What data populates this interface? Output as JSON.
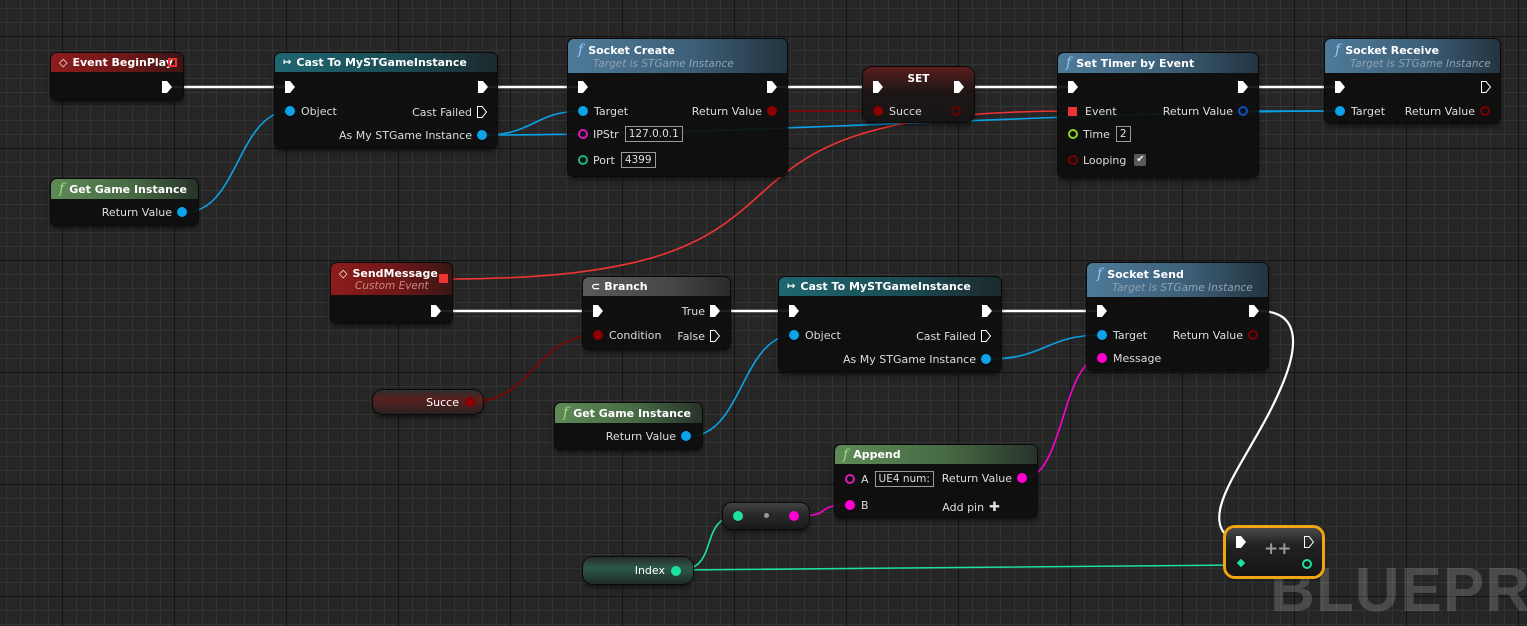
{
  "watermark": "BLUEPR",
  "colors": {
    "exec": "#ffffff",
    "object": "#0aa2e8",
    "boolean": "#8b0000",
    "string": "#ff00d4",
    "integer": "#1ee0a0",
    "float": "#9ae02a",
    "event_delegate": "#ee3333",
    "selection": "#f1a512"
  },
  "nodes": {
    "event_beginplay": {
      "title": "Event BeginPlay",
      "icon": "event-diamond-icon"
    },
    "get_game_instance_1": {
      "title": "Get Game Instance",
      "return_label": "Return Value",
      "icon": "function-icon"
    },
    "cast_1": {
      "title": "Cast To MySTGameInstance",
      "object_label": "Object",
      "cast_failed_label": "Cast Failed",
      "as_label": "As My STGame Instance",
      "icon": "cast-arrow-icon"
    },
    "socket_create": {
      "title": "Socket Create",
      "subtitle": "Target is STGame Instance",
      "target_label": "Target",
      "return_label": "Return Value",
      "ipstr_label": "IPStr",
      "ipstr_value": "127.0.0.1",
      "port_label": "Port",
      "port_value": "4399",
      "icon": "function-icon"
    },
    "set_node": {
      "title": "SET",
      "var_label": "Succe"
    },
    "set_timer": {
      "title": "Set Timer by Event",
      "event_label": "Event",
      "return_label": "Return Value",
      "time_label": "Time",
      "time_value": "2",
      "looping_label": "Looping",
      "looping_checked": true,
      "icon": "function-icon"
    },
    "socket_receive": {
      "title": "Socket Receive",
      "subtitle": "Target is STGame Instance",
      "target_label": "Target",
      "return_label": "Return Value",
      "icon": "function-icon"
    },
    "send_message": {
      "title": "SendMessage",
      "subtitle": "Custom Event",
      "icon": "event-diamond-icon"
    },
    "branch": {
      "title": "Branch",
      "condition_label": "Condition",
      "true_label": "True",
      "false_label": "False",
      "icon": "branch-icon"
    },
    "succe_var": {
      "label": "Succe"
    },
    "cast_2": {
      "title": "Cast To MySTGameInstance",
      "object_label": "Object",
      "cast_failed_label": "Cast Failed",
      "as_label": "As My STGame Instance",
      "icon": "cast-arrow-icon"
    },
    "get_game_instance_2": {
      "title": "Get Game Instance",
      "return_label": "Return Value",
      "icon": "function-icon"
    },
    "socket_send": {
      "title": "Socket Send",
      "subtitle": "Target is STGame Instance",
      "target_label": "Target",
      "message_label": "Message",
      "return_label": "Return Value",
      "icon": "function-icon"
    },
    "append": {
      "title": "Append",
      "a_label": "A",
      "a_value": "UE4 num:",
      "b_label": "B",
      "return_label": "Return Value",
      "add_pin_label": "Add pin",
      "icon": "function-icon"
    },
    "index_var": {
      "label": "Index"
    },
    "increment": {
      "title": "++"
    }
  }
}
